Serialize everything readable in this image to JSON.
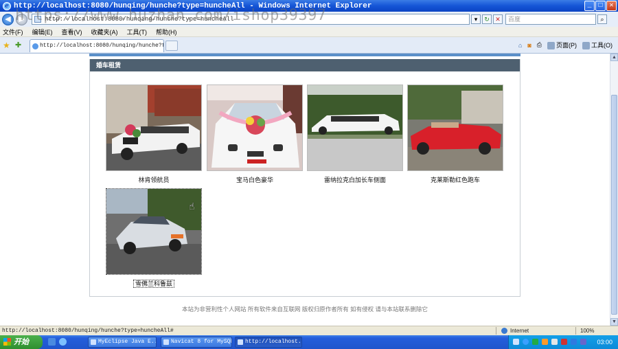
{
  "window": {
    "title": "http://localhost:8080/hunqing/hunche?type=huncheAll - Windows Internet Explorer",
    "watermark": "https://www.huzhan.com/ishop39397"
  },
  "address_bar": {
    "url": "http://localhost:8080/hunqing/hunche?type=huncheAll",
    "search_placeholder": "百度"
  },
  "menu": [
    "文件(F)",
    "编辑(E)",
    "查看(V)",
    "收藏夹(A)",
    "工具(T)",
    "帮助(H)"
  ],
  "tab": {
    "title": "http://localhost:8080/hunqing/hunche?type..."
  },
  "command_bar": {
    "page_label": "页面(P)",
    "tools_label": "工具(O)"
  },
  "page": {
    "section_title": "婚车租赁",
    "cars": [
      {
        "caption": "林肯领航员"
      },
      {
        "caption": "宝马白色豪华"
      },
      {
        "caption": "雷纳拉克白加长车侧面"
      },
      {
        "caption": "克莱斯勒红色跑车"
      },
      {
        "caption": "雪佛兰科鲁兹"
      }
    ],
    "footer": "本站为非营利性个人网站  所有软件来自互联网  版权归原作者所有  如有侵权  请与本站联系删除它"
  },
  "status_bar": {
    "url": "http://localhost:8080/hunqing/hunche?type=huncheAll#",
    "zone": "Internet",
    "zoom": "100%"
  },
  "taskbar": {
    "start_label": "开始",
    "buttons": [
      "MyEclipse Java E...",
      "Navicat 8 for MySQL",
      "http://localhost..."
    ],
    "clock": "03:00"
  }
}
